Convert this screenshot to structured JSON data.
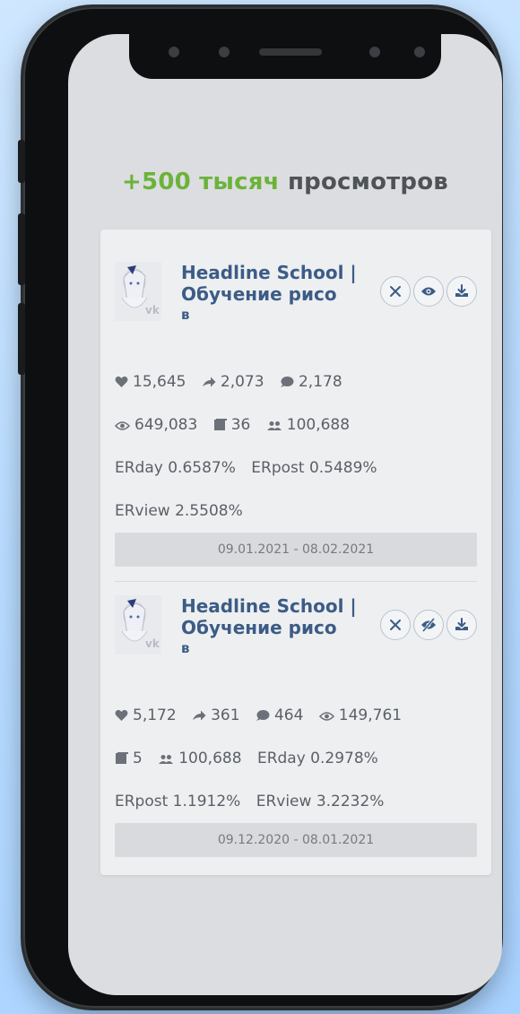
{
  "headline": {
    "highlight": "+500 тысяч",
    "rest": "просмотров"
  },
  "colors": {
    "accent_green": "#6bb33a",
    "name_blue": "#3c5c86"
  },
  "posts": [
    {
      "channel_name": "Headline School | Обучение рисо",
      "channel_name_tail": "в",
      "view_icon": "eye-icon",
      "stats_line1": [
        {
          "icon": "heart-icon",
          "value": "15,645"
        },
        {
          "icon": "share-icon",
          "value": "2,073"
        },
        {
          "icon": "comment-icon",
          "value": "2,178"
        }
      ],
      "stats_line2": [
        {
          "icon": "eye-icon",
          "value": "649,083"
        },
        {
          "icon": "posts-icon",
          "value": "36"
        },
        {
          "icon": "users-icon",
          "value": "100,688"
        }
      ],
      "erday": "ERday 0.6587%",
      "erpost": "ERpost 0.5489%",
      "erview": "ERview 2.5508%",
      "date_range": "09.01.2021 - 08.02.2021"
    },
    {
      "channel_name": "Headline School | Обучение рисо",
      "channel_name_tail": "в",
      "view_icon": "eye-slash-icon",
      "stats_line1": [
        {
          "icon": "heart-icon",
          "value": "5,172"
        },
        {
          "icon": "share-icon",
          "value": "361"
        },
        {
          "icon": "comment-icon",
          "value": "464"
        },
        {
          "icon": "eye-icon",
          "value": "149,761"
        }
      ],
      "stats_line2": [
        {
          "icon": "posts-icon",
          "value": "5"
        },
        {
          "icon": "users-icon",
          "value": "100,688"
        }
      ],
      "erday": "ERday 0.2978%",
      "erpost": "ERpost 1.1912%",
      "erview": "ERview 3.2232%",
      "date_range": "09.12.2020 - 08.01.2021"
    }
  ]
}
